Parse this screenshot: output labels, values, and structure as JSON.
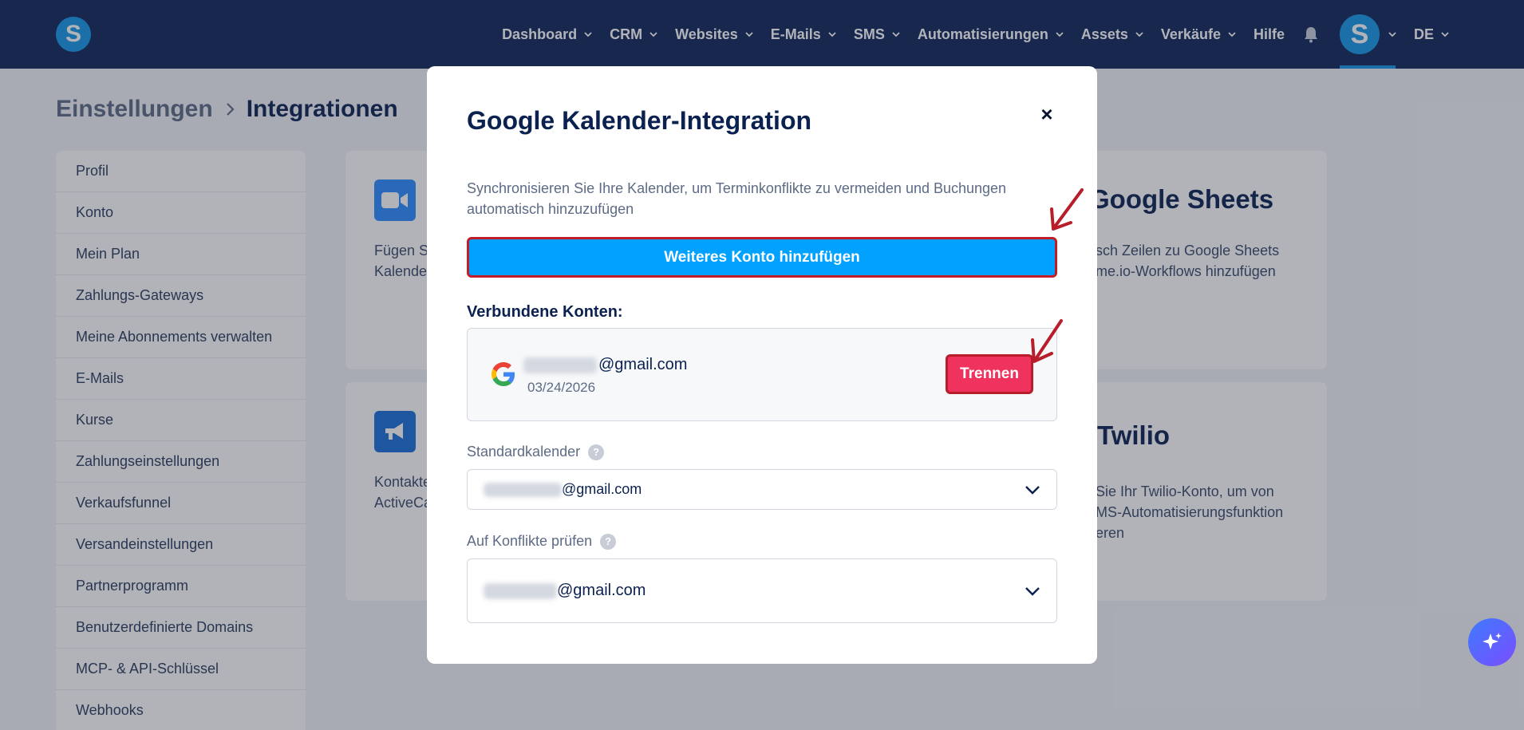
{
  "header": {
    "logo_letter": "S",
    "nav": [
      {
        "label": "Dashboard",
        "chevron": true
      },
      {
        "label": "CRM",
        "chevron": true
      },
      {
        "label": "Websites",
        "chevron": true
      },
      {
        "label": "E-Mails",
        "chevron": true
      },
      {
        "label": "SMS",
        "chevron": true
      },
      {
        "label": "Automatisierungen",
        "chevron": true
      },
      {
        "label": "Assets",
        "chevron": true
      },
      {
        "label": "Verkäufe",
        "chevron": true
      },
      {
        "label": "Hilfe",
        "chevron": false
      }
    ],
    "avatar_letter": "S",
    "language": "DE"
  },
  "breadcrumb": {
    "parent": "Einstellungen",
    "current": "Integrationen"
  },
  "sidebar": {
    "items": [
      "Profil",
      "Konto",
      "Mein Plan",
      "Zahlungs-Gateways",
      "Meine Abonnements verwalten",
      "E-Mails",
      "Kurse",
      "Zahlungseinstellungen",
      "Verkaufsfunnel",
      "Versandeinstellungen",
      "Partnerprogramm",
      "Benutzerdefinierte Domains",
      "MCP- & API-Schlüssel",
      "Webhooks"
    ]
  },
  "cards": {
    "zoom_text_1": "Fügen S",
    "zoom_text_2": "Kalende",
    "activecampaign_text_1": "Kontakte",
    "activecampaign_text_2": "ActiveCa",
    "sheets_title": "Google Sheets",
    "sheets_text_1": "sch Zeilen zu Google Sheets",
    "sheets_text_2": "me.io-Workflows hinzufügen",
    "twilio_title": "Twilio",
    "twilio_text_1": "Sie Ihr Twilio-Konto, um von",
    "twilio_text_2": "MS-Automatisierungsfunktion",
    "twilio_text_3": "eren"
  },
  "modal": {
    "title": "Google Kalender-Integration",
    "close_glyph": "×",
    "description": "Synchronisieren Sie Ihre Kalender, um Terminkonflikte zu vermeiden und Buchungen automatisch hinzuzufügen",
    "add_button": "Weiteres Konto hinzufügen",
    "connected_label": "Verbundene Konten:",
    "account": {
      "email_domain": "@gmail.com",
      "date": "03/24/2026",
      "disconnect": "Trennen"
    },
    "default_calendar": {
      "label": "Standardkalender",
      "help": "?",
      "value_domain": "@gmail.com"
    },
    "check_conflicts": {
      "label": "Auf Konflikte prüfen",
      "help": "?",
      "value_domain": "@gmail.com"
    }
  },
  "colors": {
    "navbar": "#0f2557",
    "accent": "#00a1ff",
    "danger": "#f0325e",
    "annotation": "#b81d2a"
  }
}
